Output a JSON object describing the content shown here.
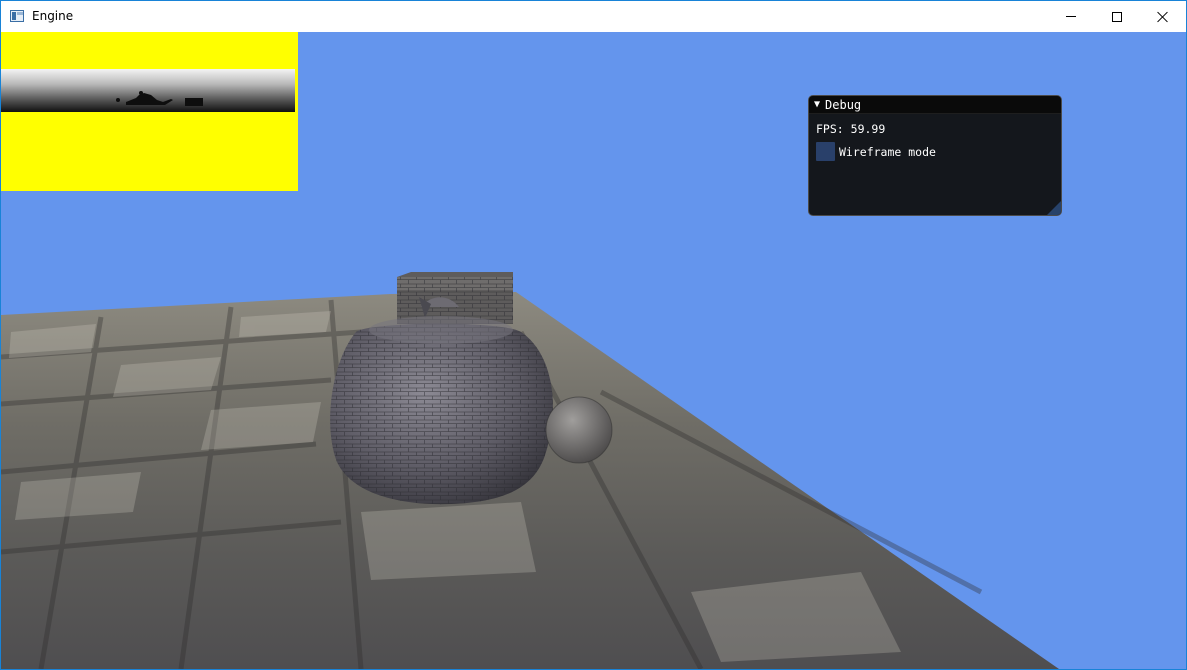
{
  "window": {
    "title": "Engine",
    "app_icon": "window-app-icon",
    "controls": {
      "minimize_icon": "minimize-icon",
      "maximize_icon": "maximize-icon",
      "close_icon": "close-icon"
    }
  },
  "viewport": {
    "clear_color": "#6495ed",
    "preview_background": "#ffff00"
  },
  "debug": {
    "title": "Debug",
    "collapse_icon": "▼",
    "fps_label": "FPS:",
    "fps_value": "59.99",
    "wireframe_label": "Wireframe mode",
    "wireframe_checked": false
  }
}
